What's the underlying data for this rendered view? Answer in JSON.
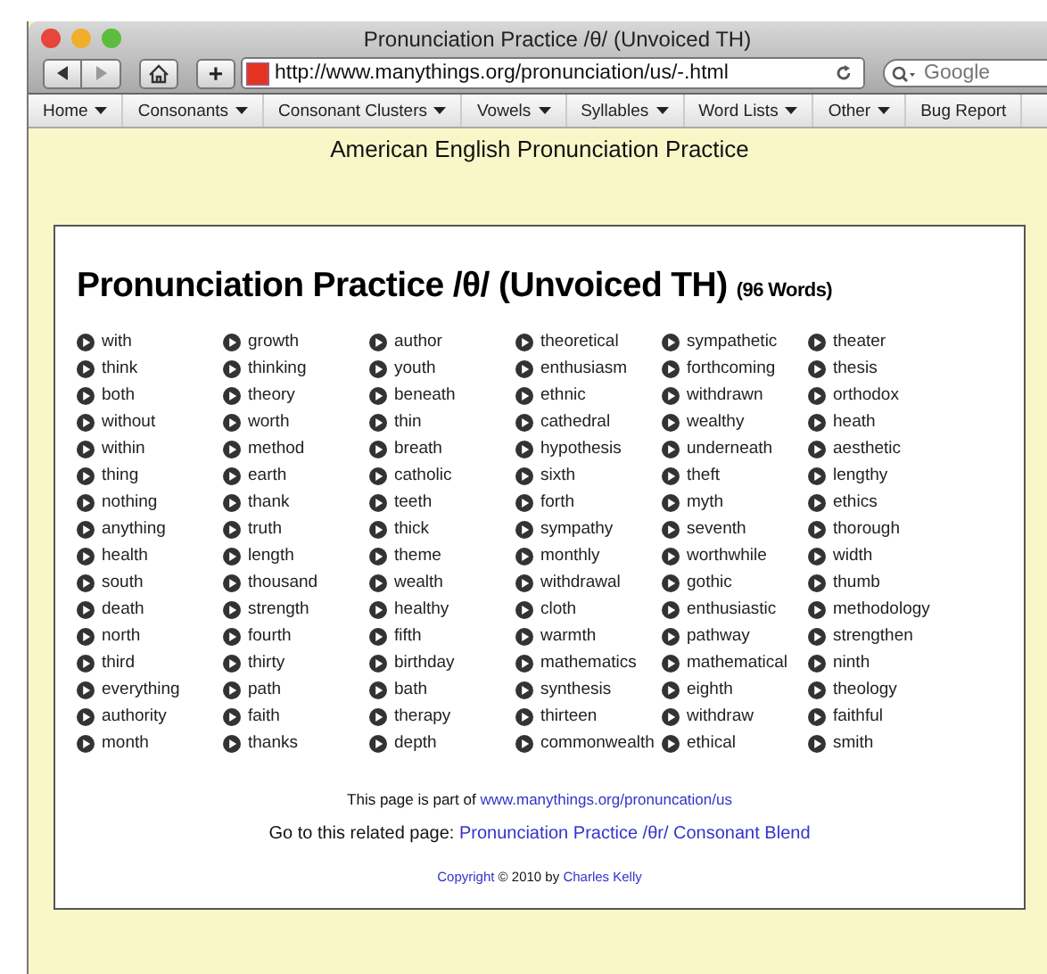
{
  "window": {
    "title": "Pronunciation Practice /θ/ (Unvoiced TH)"
  },
  "toolbar": {
    "url": "http://www.manythings.org/pronunciation/us/-.html",
    "search": {
      "placeholder": "Google"
    },
    "new_tab": "+"
  },
  "nav": [
    {
      "label": "Home",
      "kind": "menu"
    },
    {
      "label": "Consonants",
      "kind": "menu"
    },
    {
      "label": "Consonant Clusters",
      "kind": "menu"
    },
    {
      "label": "Vowels",
      "kind": "menu"
    },
    {
      "label": "Syllables",
      "kind": "menu"
    },
    {
      "label": "Word Lists",
      "kind": "menu"
    },
    {
      "label": "Other",
      "kind": "menu"
    },
    {
      "label": "Bug Report",
      "kind": "link"
    }
  ],
  "site_heading": "American English Pronunciation Practice",
  "page": {
    "title": "Pronunciation Practice /θ/ (Unvoiced TH)",
    "count": "(96 Words)",
    "columns": [
      [
        "with",
        "think",
        "both",
        "without",
        "within",
        "thing",
        "nothing",
        "anything",
        "health",
        "south",
        "death",
        "north",
        "third",
        "everything",
        "authority",
        "month"
      ],
      [
        "growth",
        "thinking",
        "theory",
        "worth",
        "method",
        "earth",
        "thank",
        "truth",
        "length",
        "thousand",
        "strength",
        "fourth",
        "thirty",
        "path",
        "faith",
        "thanks"
      ],
      [
        "author",
        "youth",
        "beneath",
        "thin",
        "breath",
        "catholic",
        "teeth",
        "thick",
        "theme",
        "wealth",
        "healthy",
        "fifth",
        "birthday",
        "bath",
        "therapy",
        "depth"
      ],
      [
        "theoretical",
        "enthusiasm",
        "ethnic",
        "cathedral",
        "hypothesis",
        "sixth",
        "forth",
        "sympathy",
        "monthly",
        "withdrawal",
        "cloth",
        "warmth",
        "mathematics",
        "synthesis",
        "thirteen",
        "commonwealth"
      ],
      [
        "sympathetic",
        "forthcoming",
        "withdrawn",
        "wealthy",
        "underneath",
        "theft",
        "myth",
        "seventh",
        "worthwhile",
        "gothic",
        "enthusiastic",
        "pathway",
        "mathematical",
        "eighth",
        "withdraw",
        "ethical"
      ],
      [
        "theater",
        "thesis",
        "orthodox",
        "heath",
        "aesthetic",
        "lengthy",
        "ethics",
        "thorough",
        "width",
        "thumb",
        "methodology",
        "strengthen",
        "ninth",
        "theology",
        "faithful",
        "smith"
      ]
    ],
    "part_of": {
      "text": "This page is part of",
      "link": "www.manythings.org/pronuncation/us"
    },
    "related": {
      "text": "Go to this related page:",
      "link": "Pronunciation Practice /θr/ Consonant Blend"
    },
    "copyright": {
      "link": "Copyright",
      "text": "© 2010 by",
      "author": "Charles Kelly"
    }
  }
}
